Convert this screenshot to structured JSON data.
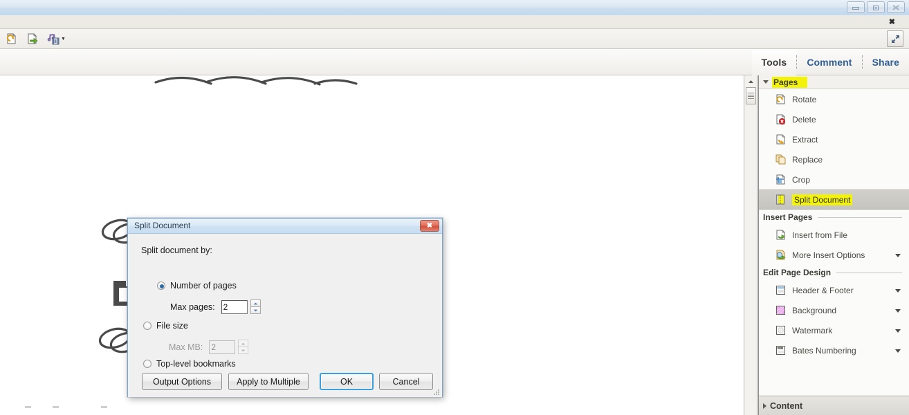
{
  "window": {
    "controls": [
      {
        "name": "minimize",
        "glyph": "minimize-icon"
      },
      {
        "name": "restore",
        "glyph": "restore-icon"
      },
      {
        "name": "close",
        "glyph": "close-icon"
      }
    ],
    "menu_close_glyph": "✖"
  },
  "toolbar": {
    "buttons": [
      {
        "name": "rotate-page-icon",
        "label": "Rotate Page"
      },
      {
        "name": "insert-page-icon",
        "label": "Insert Page"
      },
      {
        "name": "multimedia-icon",
        "label": "Multimedia"
      }
    ],
    "expand_label": "Expand Toolbar"
  },
  "tcs": {
    "items": [
      {
        "label": "Tools",
        "state": "active"
      },
      {
        "label": "Comment",
        "state": "link"
      },
      {
        "label": "Share",
        "state": "link"
      }
    ]
  },
  "panel": {
    "options_icon": "panel-options-icon",
    "pages_section": {
      "label": "Pages",
      "expanded": true,
      "highlighted": true,
      "items": [
        {
          "label": "Rotate",
          "icon": "rotate-icon",
          "selected": false,
          "highlighted": false,
          "dropdown": false
        },
        {
          "label": "Delete",
          "icon": "delete-icon",
          "selected": false,
          "highlighted": false,
          "dropdown": false
        },
        {
          "label": "Extract",
          "icon": "extract-icon",
          "selected": false,
          "highlighted": false,
          "dropdown": false
        },
        {
          "label": "Replace",
          "icon": "replace-icon",
          "selected": false,
          "highlighted": false,
          "dropdown": false
        },
        {
          "label": "Crop",
          "icon": "crop-icon",
          "selected": false,
          "highlighted": false,
          "dropdown": false
        },
        {
          "label": "Split Document",
          "icon": "split-document-icon",
          "selected": true,
          "highlighted": true,
          "dropdown": false
        }
      ]
    },
    "insert_pages_group": {
      "label": "Insert Pages",
      "items": [
        {
          "label": "Insert from File",
          "icon": "insert-from-file-icon",
          "dropdown": false
        },
        {
          "label": "More Insert Options",
          "icon": "more-insert-options-icon",
          "dropdown": true
        }
      ]
    },
    "edit_page_design_group": {
      "label": "Edit Page Design",
      "items": [
        {
          "label": "Header & Footer",
          "icon": "header-footer-icon",
          "dropdown": true
        },
        {
          "label": "Background",
          "icon": "background-icon",
          "dropdown": true
        },
        {
          "label": "Watermark",
          "icon": "watermark-icon",
          "dropdown": true
        },
        {
          "label": "Bates Numbering",
          "icon": "bates-numbering-icon",
          "dropdown": true
        }
      ]
    },
    "content_section": {
      "label": "Content",
      "expanded": false
    }
  },
  "dialog": {
    "title": "Split Document",
    "close_glyph": "✖",
    "prompt": "Split document by:",
    "options": [
      {
        "id": "number-of-pages",
        "label": "Number of pages",
        "selected": true,
        "field_label": "Max pages:",
        "field_value": "2",
        "field_enabled": true
      },
      {
        "id": "file-size",
        "label": "File size",
        "selected": false,
        "field_label": "Max MB:",
        "field_value": "2",
        "field_enabled": false
      },
      {
        "id": "top-level-bookmarks",
        "label": "Top-level bookmarks",
        "selected": false
      }
    ],
    "buttons": [
      {
        "label": "Output Options",
        "focused": false
      },
      {
        "label": "Apply to Multiple",
        "focused": false
      },
      {
        "label": "OK",
        "focused": true
      },
      {
        "label": "Cancel",
        "focused": false
      }
    ]
  },
  "colors": {
    "highlight_yellow": "#f2f20a",
    "focus_blue": "#3c9fdc",
    "link_blue": "#2f5f96",
    "radio_blue": "#2b6ca8"
  }
}
